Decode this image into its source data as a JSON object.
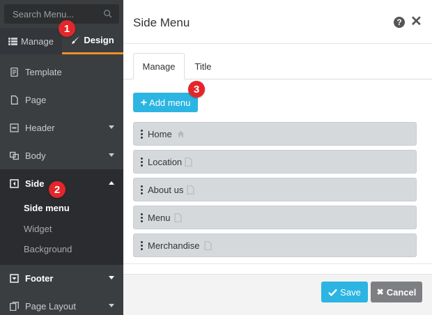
{
  "sidebar": {
    "search_placeholder": "Search Menu...",
    "tabs": {
      "manage": "Manage",
      "design": "Design"
    },
    "items": {
      "template": "Template",
      "page": "Page",
      "header": "Header",
      "body": "Body",
      "side": "Side",
      "footer": "Footer",
      "page_layout": "Page Layout"
    },
    "side_submenu": {
      "side_menu": "Side menu",
      "widget": "Widget",
      "background": "Background"
    }
  },
  "badges": {
    "one": "1",
    "two": "2",
    "three": "3"
  },
  "dialog": {
    "title": "Side Menu",
    "tabs": {
      "manage": "Manage",
      "title": "Title"
    },
    "add_button": "Add menu",
    "rows": [
      "Home",
      "Location",
      "About us",
      "Menu",
      "Merchandise"
    ],
    "save_button": "Save",
    "cancel_button": "Cancel"
  },
  "colors": {
    "accent": "#2cb5e2",
    "tab_underline": "#f28c28",
    "badge": "#e4262a",
    "sidebar_bg": "#3b3e41"
  }
}
